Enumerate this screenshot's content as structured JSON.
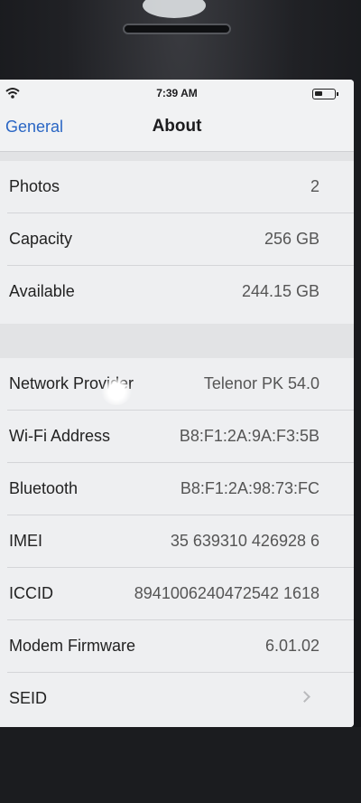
{
  "status_bar": {
    "time": "7:39 AM"
  },
  "nav": {
    "back_label": "General",
    "title": "About"
  },
  "group1": [
    {
      "label": "Photos",
      "value": "2"
    },
    {
      "label": "Capacity",
      "value": "256 GB"
    },
    {
      "label": "Available",
      "value": "244.15 GB"
    }
  ],
  "group2": [
    {
      "label": "Network Provider",
      "value": "Telenor PK 54.0"
    },
    {
      "label": "Wi-Fi Address",
      "value": "B8:F1:2A:9A:F3:5B"
    },
    {
      "label": "Bluetooth",
      "value": "B8:F1:2A:98:73:FC"
    },
    {
      "label": "IMEI",
      "value": "35 639310 426928 6"
    },
    {
      "label": "ICCID",
      "value": "8941006240472542 1618"
    },
    {
      "label": "Modem Firmware",
      "value": "6.01.02"
    },
    {
      "label": "SEID",
      "value": ""
    }
  ],
  "colors": {
    "link": "#2a66c4",
    "screen_bg": "#e7e8ea"
  }
}
